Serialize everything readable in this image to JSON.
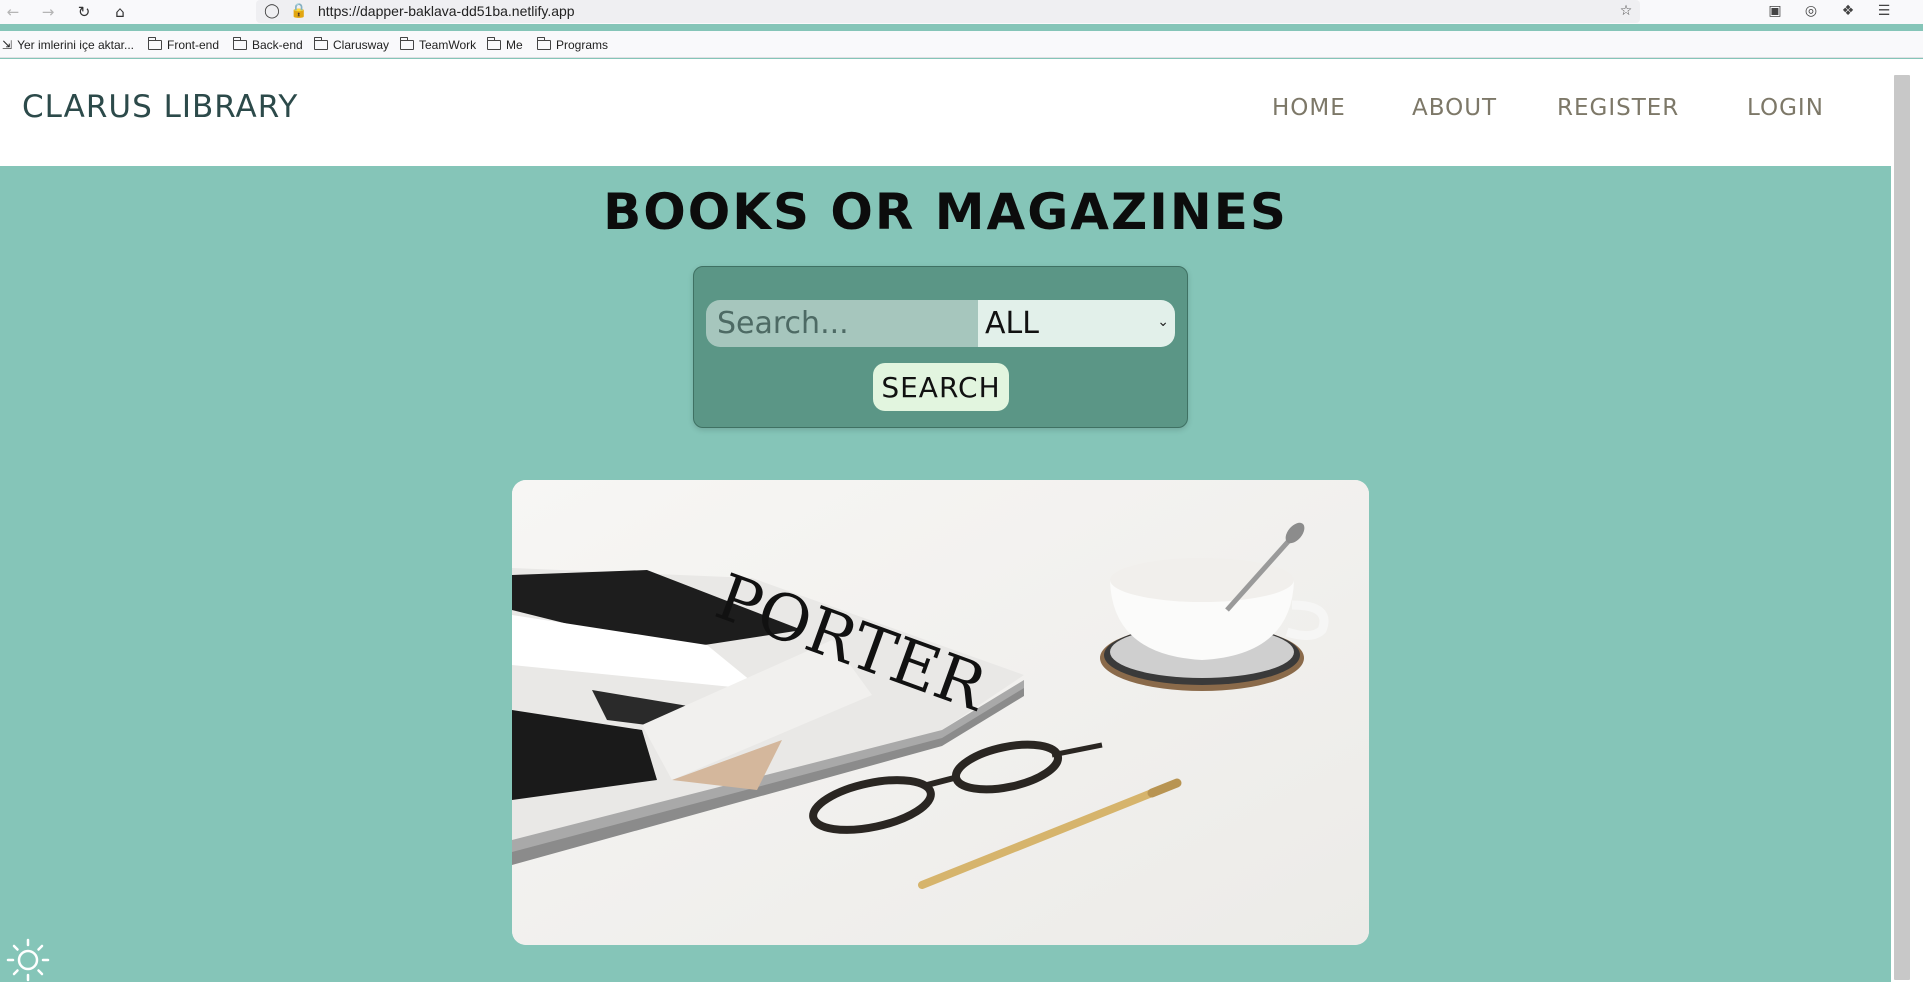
{
  "browser": {
    "url": "https://dapper-baklava-dd51ba.netlify.app",
    "bookmarks": [
      {
        "label": "Yer imlerini içe aktar...",
        "icon": "import-icon"
      },
      {
        "label": "Front-end",
        "icon": "folder-icon"
      },
      {
        "label": "Back-end",
        "icon": "folder-icon"
      },
      {
        "label": "Clarusway",
        "icon": "folder-icon"
      },
      {
        "label": "TeamWork",
        "icon": "folder-icon"
      },
      {
        "label": "Me",
        "icon": "folder-icon"
      },
      {
        "label": "Programs",
        "icon": "folder-icon"
      }
    ]
  },
  "header": {
    "brand": "CLARUS LIBRARY",
    "nav": [
      "HOME",
      "ABOUT",
      "REGISTER",
      "LOGIN"
    ]
  },
  "main": {
    "title": "BOOKS OR MAGAZINES",
    "search": {
      "placeholder": "Search...",
      "category": "ALL",
      "button": "SEARCH"
    }
  },
  "colors": {
    "page_bg": "#85c5b8",
    "search_panel": "#5b9686",
    "header_text": "#2c4a4a",
    "nav_text": "#7d7868"
  }
}
